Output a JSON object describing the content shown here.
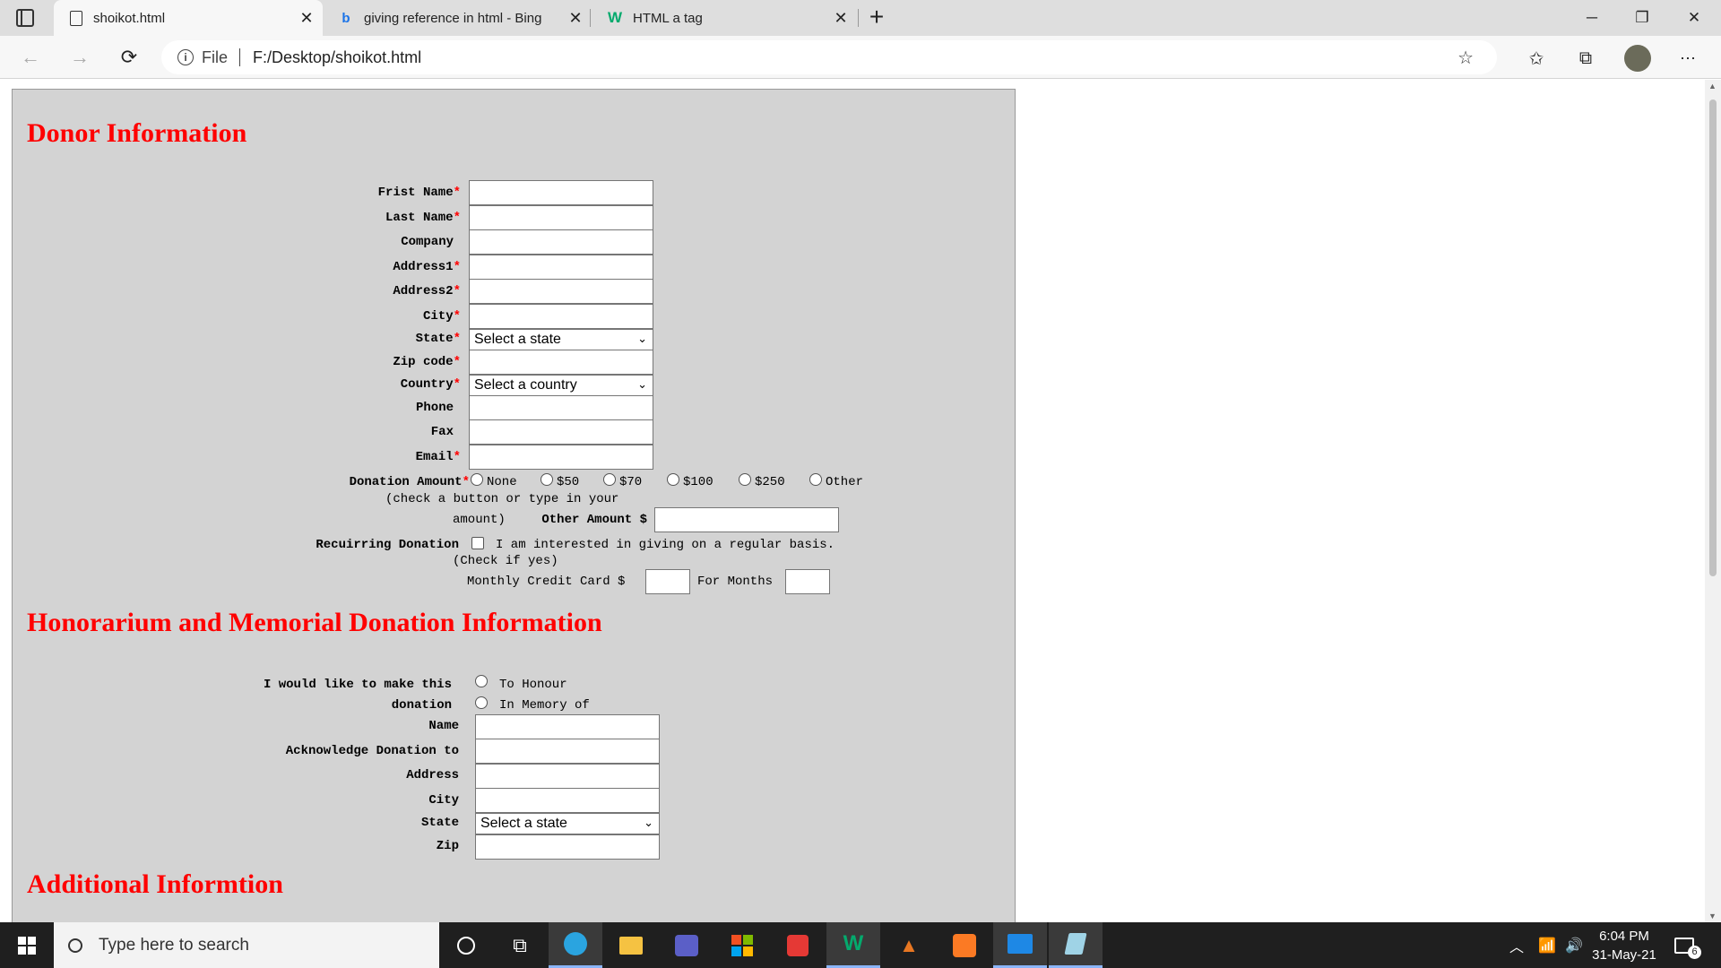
{
  "browser": {
    "tabs": [
      {
        "label": "shoikot.html",
        "icon": "page-icon",
        "active": true
      },
      {
        "label": "giving reference in html - Bing",
        "icon": "bing-icon",
        "active": false
      },
      {
        "label": "HTML a tag",
        "icon": "w3schools-icon",
        "active": false
      }
    ],
    "new_tab": "+",
    "address": {
      "scheme": "File",
      "url": "F:/Desktop/shoikot.html"
    }
  },
  "form": {
    "donor_title": "Donor Information",
    "fields": [
      {
        "label": "Frist Name",
        "required": true
      },
      {
        "label": "Last Name",
        "required": true
      },
      {
        "label": "Company",
        "required": false
      },
      {
        "label": "Address1",
        "required": true
      },
      {
        "label": "Address2",
        "required": true
      },
      {
        "label": "City",
        "required": true
      },
      {
        "label": "State",
        "required": true,
        "select": "Select a state"
      },
      {
        "label": "Zip code",
        "required": true
      },
      {
        "label": "Country",
        "required": true,
        "select": "Select a country"
      },
      {
        "label": "Phone",
        "required": false
      },
      {
        "label": "Fax",
        "required": false
      },
      {
        "label": "Email",
        "required": true
      }
    ],
    "required_marker": "*",
    "donation": {
      "label": "Donation Amount",
      "hint_line1": "(check a button or type in your",
      "hint_line2": "amount)",
      "options": [
        "None",
        "$50",
        "$70",
        "$100",
        "$250",
        "Other"
      ],
      "other_amount_label": "Other Amount $"
    },
    "recurring": {
      "label": "Recuirring Donation",
      "checkbox_text": "I am interested in giving on a regular basis.",
      "hint": "(Check if yes)",
      "monthly_label": "Monthly Credit Card $",
      "months_label": "For Months"
    },
    "honor_title": "Honorarium and Memorial Donation Information",
    "honor": {
      "make_label_line1": "I would like to make this",
      "make_label_line2": "donation",
      "options": [
        "To Honour",
        "In Memory of"
      ],
      "fields": [
        {
          "label": "Name"
        },
        {
          "label": "Acknowledge Donation to"
        },
        {
          "label": "Address"
        },
        {
          "label": "City"
        },
        {
          "label": "State",
          "select": "Select a state"
        },
        {
          "label": "Zip"
        }
      ]
    },
    "additional_title": "Additional Informtion"
  },
  "taskbar": {
    "search_placeholder": "Type here to search",
    "time": "6:04 PM",
    "date": "31-May-21",
    "notifications": "6"
  }
}
